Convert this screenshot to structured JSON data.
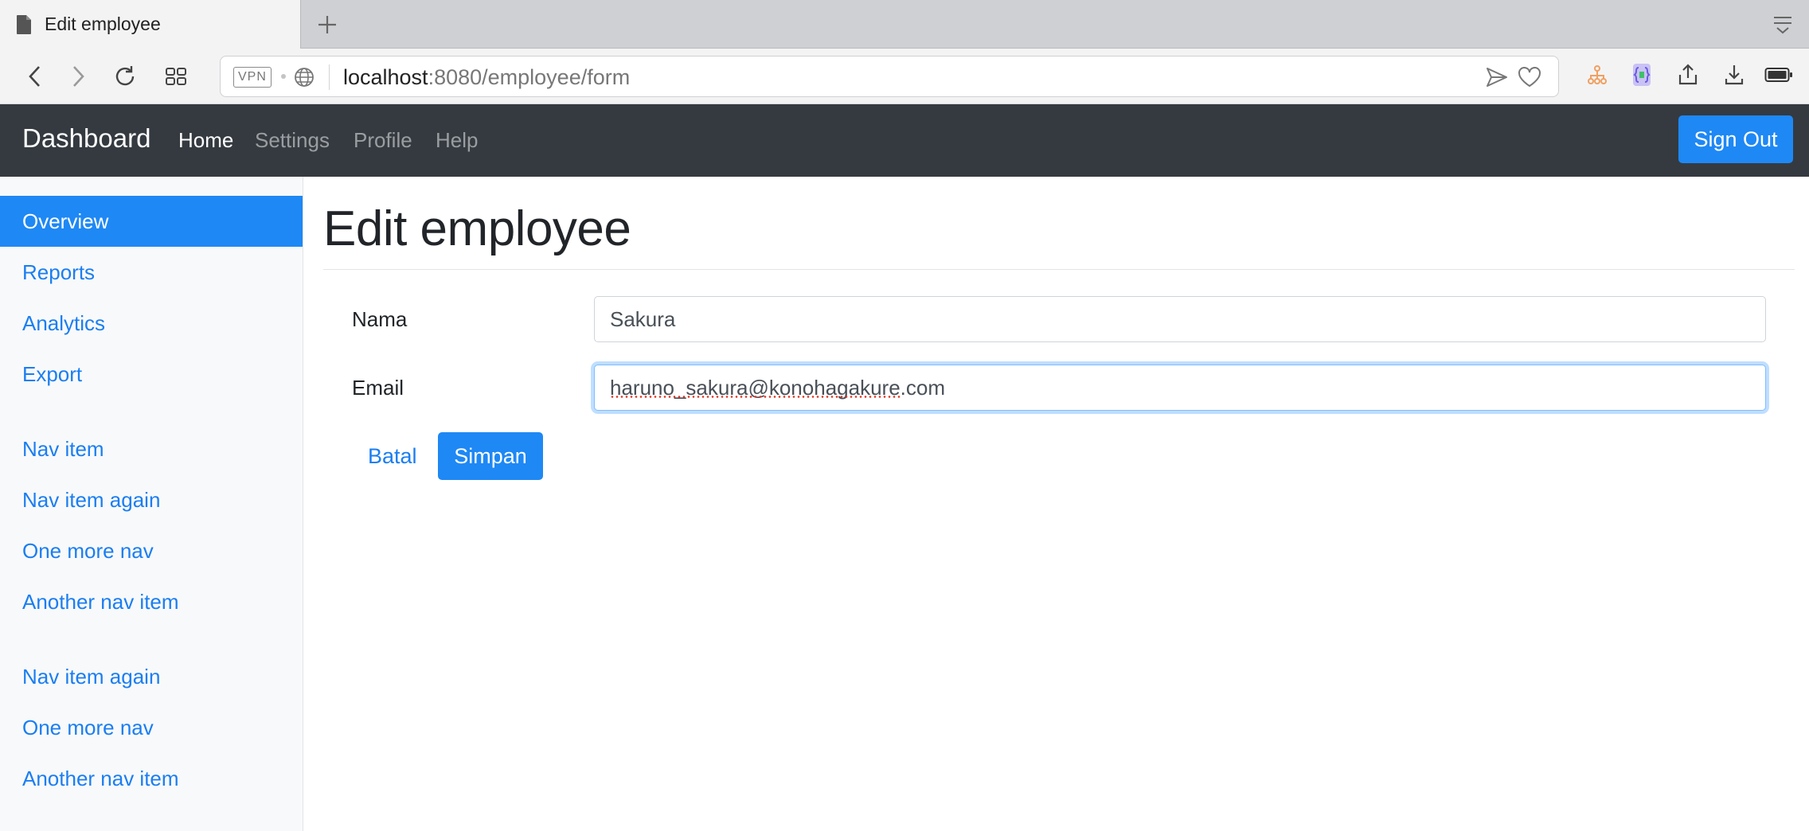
{
  "browser": {
    "tab_title": "Edit employee",
    "url_host": "localhost",
    "url_rest": ":8080/employee/form",
    "vpn_label": "VPN",
    "icons": [
      "document-icon",
      "plus-icon",
      "tab-list-icon",
      "back-icon",
      "forward-icon",
      "reload-icon",
      "grid-icon",
      "globe-icon",
      "send-icon",
      "heart-icon",
      "sitemap-icon",
      "extension-icon",
      "share-icon",
      "download-icon",
      "battery-icon"
    ]
  },
  "navbar": {
    "brand": "Dashboard",
    "links": [
      {
        "label": "Home",
        "active": true
      },
      {
        "label": "Settings",
        "active": false
      },
      {
        "label": "Profile",
        "active": false
      },
      {
        "label": "Help",
        "active": false
      }
    ],
    "signout_label": "Sign Out"
  },
  "sidebar": {
    "groups": [
      [
        "Overview",
        "Reports",
        "Analytics",
        "Export"
      ],
      [
        "Nav item",
        "Nav item again",
        "One more nav",
        "Another nav item"
      ],
      [
        "Nav item again",
        "One more nav",
        "Another nav item"
      ]
    ],
    "active": "Overview"
  },
  "main": {
    "title": "Edit employee",
    "fields": [
      {
        "label": "Nama",
        "value": "Sakura"
      },
      {
        "label": "Email",
        "value": "haruno_sakura@konohagakure.com"
      }
    ],
    "cancel_label": "Batal",
    "save_label": "Simpan"
  },
  "colors": {
    "primary": "#1e88f5",
    "navbar_bg": "#343a40",
    "sidebar_bg": "#f8f9fa",
    "link": "#1a7ef2"
  }
}
